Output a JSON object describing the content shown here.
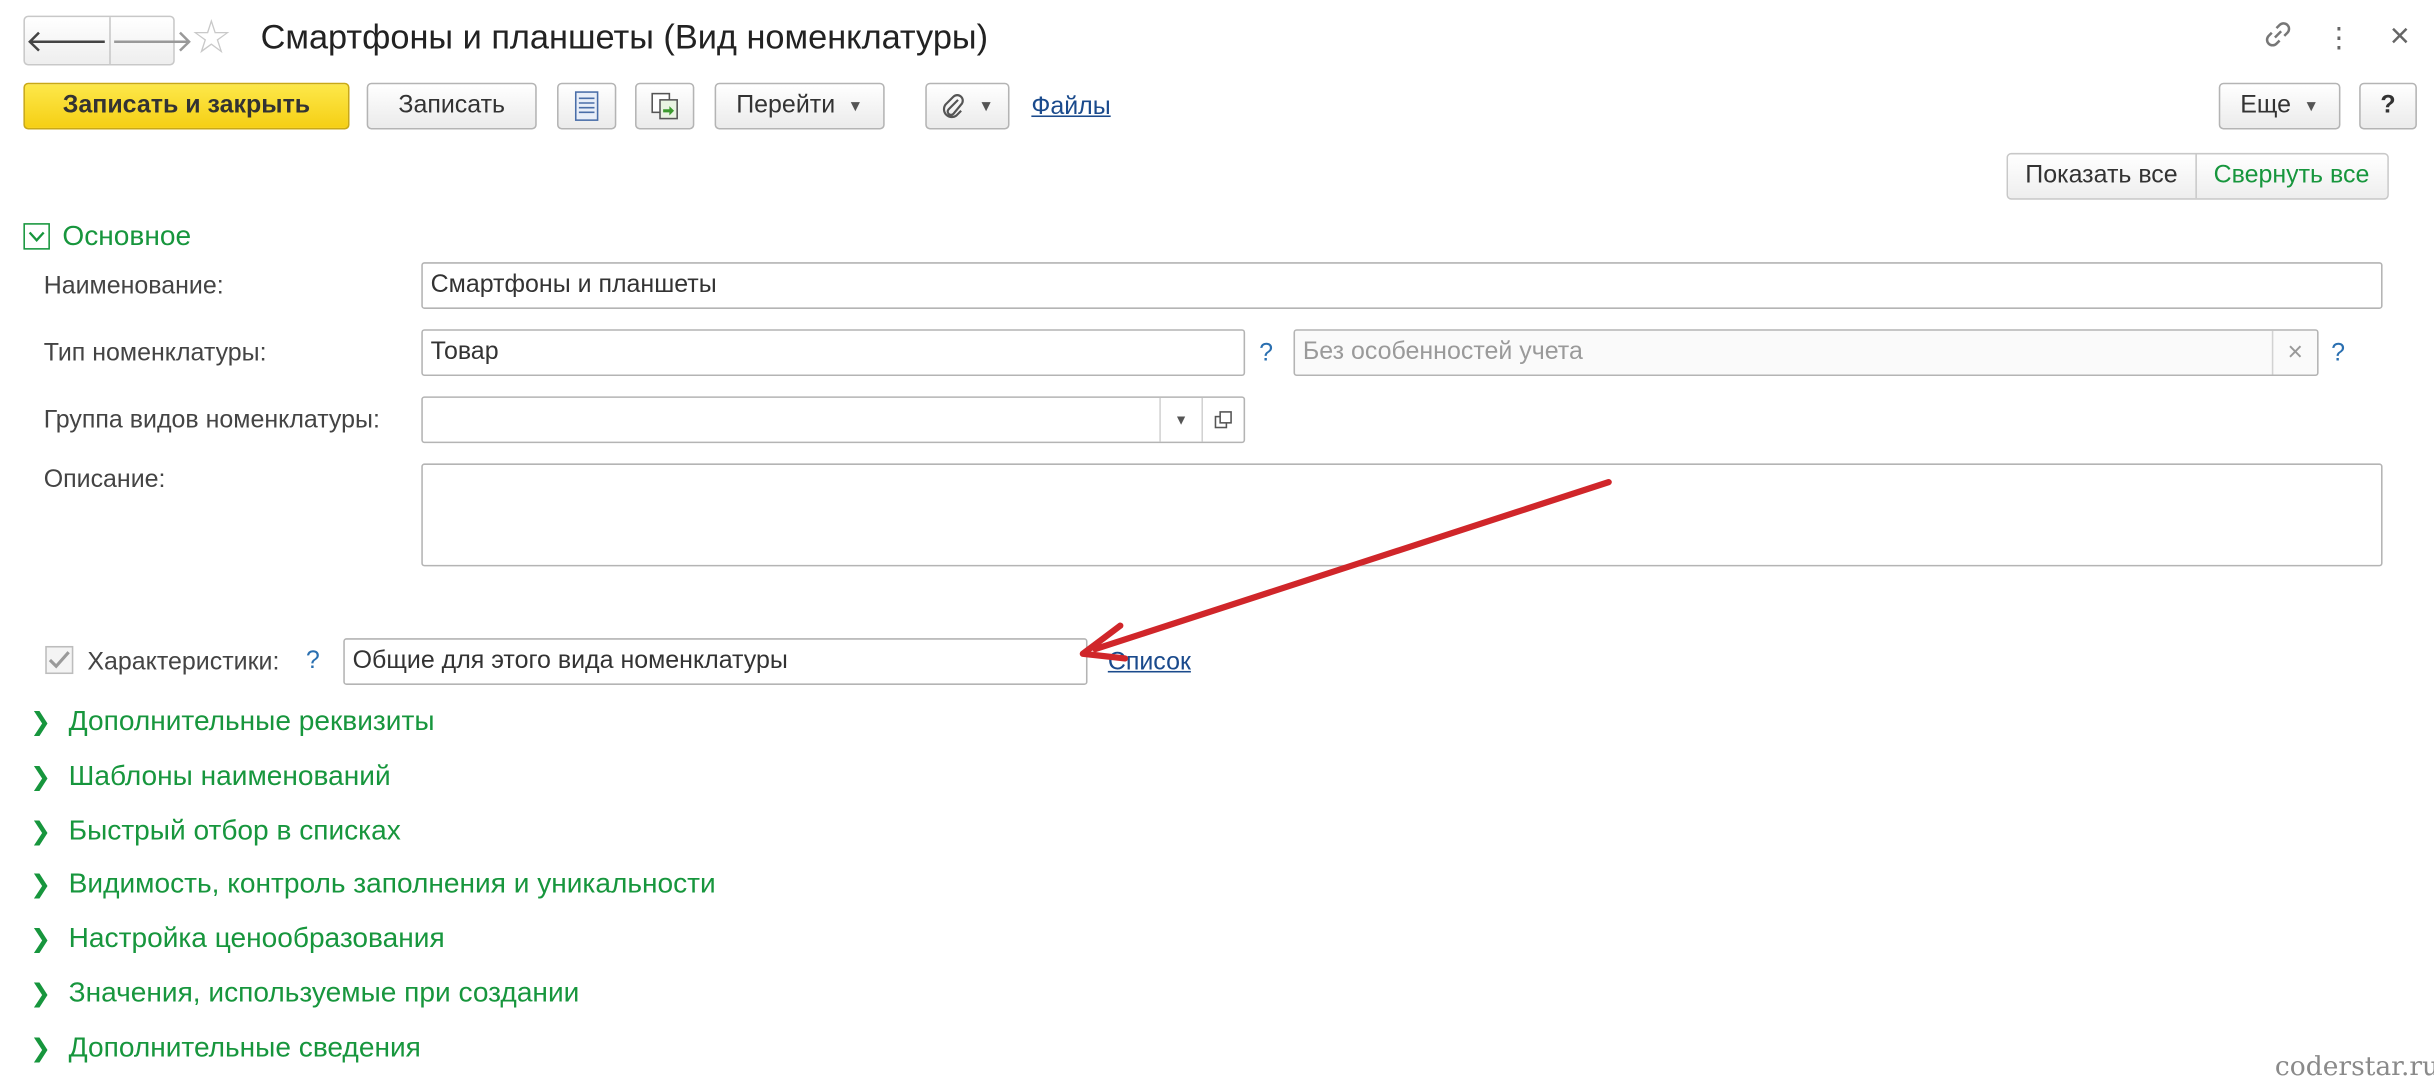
{
  "window": {
    "title": "Смартфоны и планшеты (Вид номенклатуры)",
    "nav_back": "🡐",
    "nav_forward": "🡒",
    "favorite_icon": "star-icon",
    "link_icon": "🔗",
    "menu_icon": "⋮",
    "close_icon": "×"
  },
  "toolbar": {
    "save_close": "Записать и закрыть",
    "save": "Записать",
    "goto": "Перейти",
    "files": "Файлы",
    "more": "Еще",
    "help": "?"
  },
  "view_controls": {
    "show_all": "Показать все",
    "collapse_all": "Свернуть все"
  },
  "main_group": {
    "title": "Основное",
    "name_label": "Наименование:",
    "name_value": "Смартфоны и планшеты",
    "type_label": "Тип номенклатуры:",
    "type_value": "Товар",
    "type_help": "?",
    "accounting_placeholder": "Без особенностей учета",
    "accounting_clear": "×",
    "accounting_help": "?",
    "group_label": "Группа видов номенклатуры:",
    "group_value": "",
    "description_label": "Описание:",
    "description_value": "",
    "characteristics_label": "Характеристики:",
    "characteristics_help": "?",
    "characteristics_value": "Общие для этого вида номенклатуры",
    "characteristics_link": "Список"
  },
  "collapsed_groups": [
    "Дополнительные реквизиты",
    "Шаблоны наименований",
    "Быстрый отбор в списках",
    "Видимость, контроль заполнения и уникальности",
    "Настройка ценообразования",
    "Значения, используемые при создании",
    "Дополнительные сведения"
  ],
  "watermark": "coderstar.ru",
  "colors": {
    "group_green": "#17963d",
    "primary_yellow": "#f5cf14",
    "link_blue": "#1a4a8c",
    "arrow_red": "#d0262a"
  }
}
